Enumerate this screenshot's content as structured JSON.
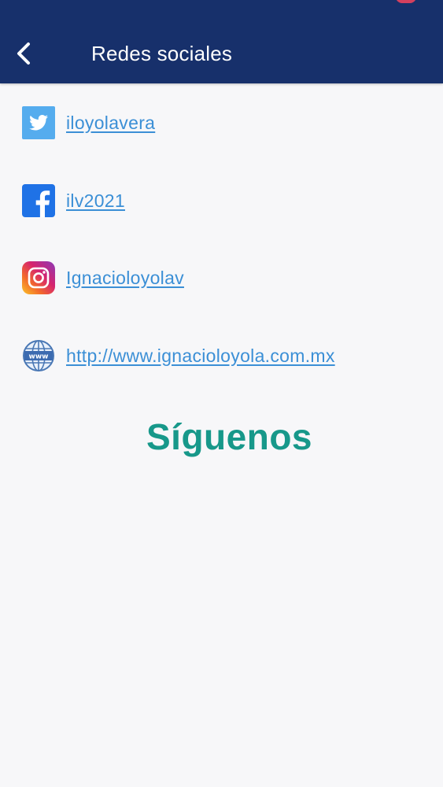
{
  "header": {
    "title": "Redes sociales",
    "background_color": "#17306b",
    "back_icon": "chevron-left-icon"
  },
  "social_links": [
    {
      "network": "twitter",
      "icon": "twitter-icon",
      "label": "iloyolavera"
    },
    {
      "network": "facebook",
      "icon": "facebook-icon",
      "label": "ilv2021"
    },
    {
      "network": "instagram",
      "icon": "instagram-icon",
      "label": "Ignacioloyolav"
    },
    {
      "network": "website",
      "icon": "globe-www-icon",
      "label": "http://www.ignacioloyola.com.mx"
    }
  ],
  "follow_text": "Síguenos",
  "colors": {
    "link": "#3b8fd6",
    "follow": "#17988a",
    "background": "#f7f7f9"
  }
}
